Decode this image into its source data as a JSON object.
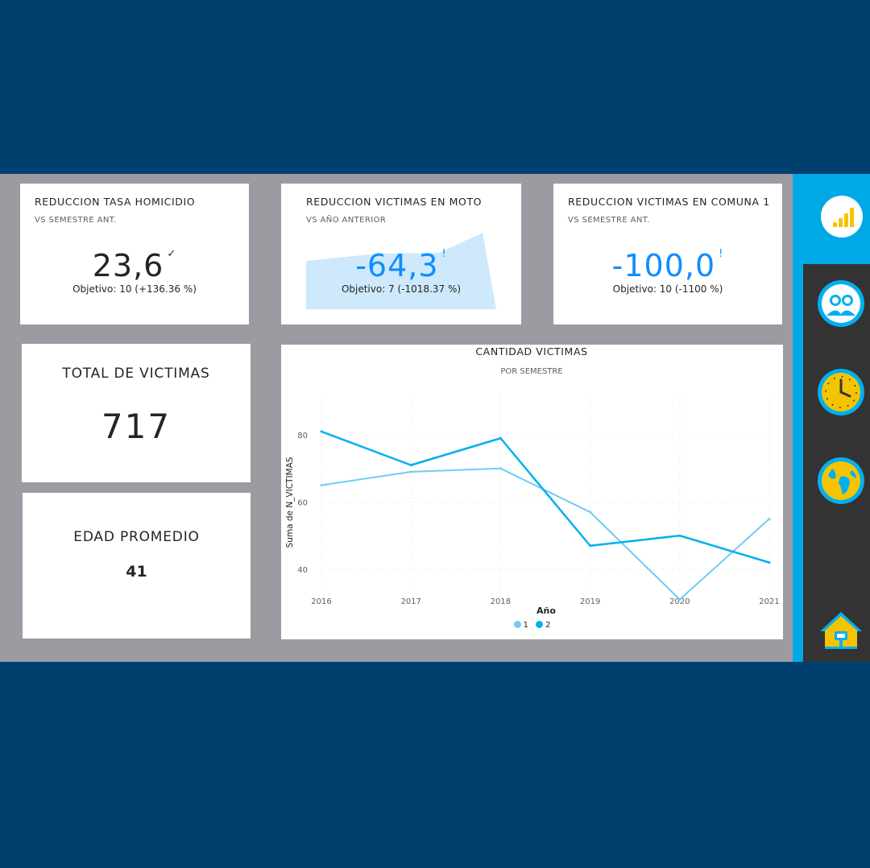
{
  "colors": {
    "background": "#00406e",
    "canvas": "#9b9ba1",
    "accent": "#00a8e6",
    "kpi_blue": "#118dff",
    "series_1": "#6ccdf5",
    "series_2": "#00b0ef",
    "area_fill": "#cde9fb"
  },
  "kpis": [
    {
      "title": "REDUCCION TASA HOMICIDIO",
      "subtitle": "VS SEMESTRE ANT.",
      "value": "23,6",
      "mark": "✓",
      "goal": "Objetivo: 10 (+136.36 %)",
      "color": "#252423"
    },
    {
      "title": "REDUCCION VICTIMAS EN MOTO",
      "subtitle": "VS AÑO ANTERIOR",
      "value": "-64,3",
      "mark": "!",
      "goal": "Objetivo: 7 (-1018.37 %)",
      "color": "#118dff"
    },
    {
      "title": "REDUCCION VICTIMAS EN COMUNA 1",
      "subtitle": "VS SEMESTRE ANT.",
      "value": "-100,0",
      "mark": "!",
      "goal": "Objetivo: 10 (-1100 %)",
      "color": "#118dff"
    }
  ],
  "total_victimas": {
    "title": "TOTAL DE VICTIMAS",
    "value": "717"
  },
  "edad_promedio": {
    "title": "EDAD PROMEDIO",
    "value": "41"
  },
  "nav": [
    {
      "name": "reports-icon"
    },
    {
      "name": "people-icon"
    },
    {
      "name": "clock-icon"
    },
    {
      "name": "globe-icon"
    },
    {
      "name": "home-icon"
    }
  ],
  "chart_data": {
    "type": "line",
    "title": "CANTIDAD VICTIMAS",
    "subtitle": "POR SEMESTRE",
    "xlabel": "Año",
    "ylabel": "Suma de N_VICTIMAS",
    "x": [
      "2016",
      "2017",
      "2018",
      "2019",
      "2020",
      "2021"
    ],
    "yticks": [
      40,
      60,
      80
    ],
    "ylim": [
      34,
      92
    ],
    "grid": true,
    "legend_position": "bottom",
    "series": [
      {
        "name": "1",
        "values": [
          65,
          69,
          70,
          57,
          31,
          55
        ],
        "color": "#6ccdf5"
      },
      {
        "name": "2",
        "values": [
          81,
          71,
          79,
          47,
          50,
          42
        ],
        "color": "#00b0ef"
      }
    ]
  }
}
